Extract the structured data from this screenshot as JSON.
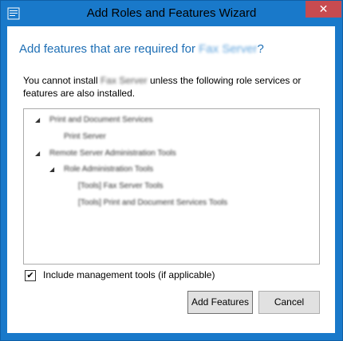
{
  "window": {
    "title": "Add Roles and Features Wizard",
    "close_glyph": "✕"
  },
  "heading": {
    "prefix": "Add features that are required for ",
    "feature": "Fax Server",
    "suffix": "?"
  },
  "description": {
    "part1": "You cannot install ",
    "feature": "Fax Server",
    "part2": " unless the following role services or features are also installed."
  },
  "tree": [
    {
      "label": "Print and Document Services",
      "expander": "◢"
    },
    {
      "label": "Print Server",
      "expander": ""
    },
    {
      "label": "Remote Server Administration Tools",
      "expander": "◢"
    },
    {
      "label": "Role Administration Tools",
      "expander": "◢"
    },
    {
      "label": "[Tools] Fax Server Tools",
      "expander": ""
    },
    {
      "label": "[Tools] Print and Document Services Tools",
      "expander": ""
    }
  ],
  "include_tools": {
    "checked_glyph": "✔",
    "label": "Include management tools (if applicable)"
  },
  "buttons": {
    "add": "Add Features",
    "cancel": "Cancel"
  },
  "colors": {
    "accent": "#1979ca",
    "heading": "#1e6fb5",
    "close": "#c74b50"
  }
}
